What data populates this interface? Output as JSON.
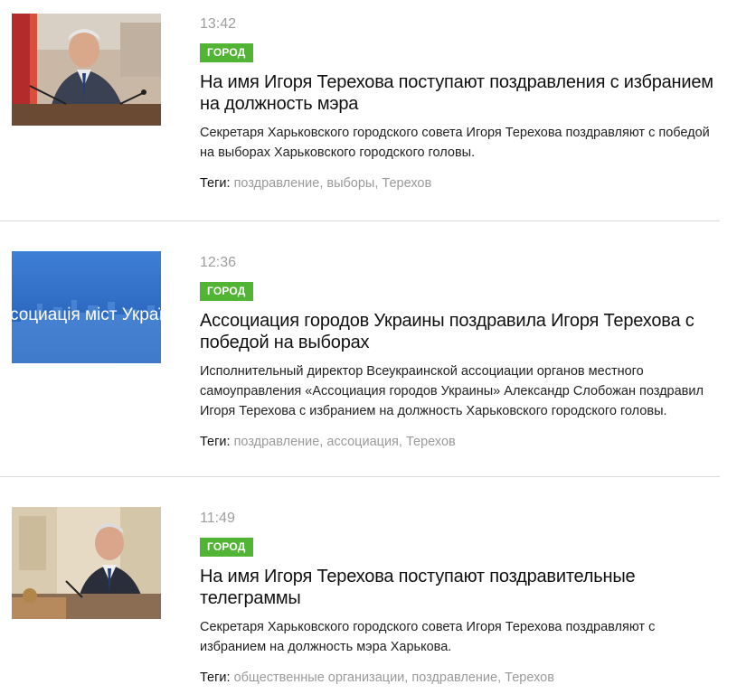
{
  "articles": [
    {
      "time": "13:42",
      "category": "ГОРОД",
      "title": "На имя Игоря Терехова поступают поздравления с избранием на должность мэра",
      "description": "Секретаря Харьковского городского совета Игоря Терехова поздравляют с победой на выборах Харьковского городского головы.",
      "tags_label": "Теги:",
      "tags": [
        "поздравление",
        "выборы",
        "Терехов"
      ],
      "thumbnail": "man-at-microphone-photo"
    },
    {
      "time": "12:36",
      "category": "ГОРОД",
      "title": "Ассоциация городов Украины поздравила Игоря Терехова с победой на выборах",
      "description": "Исполнительный директор Всеукраинской ассоциации органов местного самоуправления «Ассоциация городов Украины» Александр Слобожан поздравил Игоря Терехова с избранием на должность Харьковского городского головы.",
      "tags_label": "Теги:",
      "tags": [
        "поздравление",
        "ассоциация",
        "Терехов"
      ],
      "thumbnail": "association-logo-banner",
      "thumbnail_text": "социація міст Украї"
    },
    {
      "time": "11:49",
      "category": "ГОРОД",
      "title": "На имя Игоря Терехова поступают поздравительные телеграммы",
      "description": "Секретаря Харьковского городского совета Игоря Терехова поздравляют с избранием на должность мэра Харькова.",
      "tags_label": "Теги:",
      "tags": [
        "общественные организации",
        "поздравление",
        "Терехов"
      ],
      "thumbnail": "man-at-desk-photo"
    }
  ],
  "colors": {
    "badge_green": "#52b435",
    "tag_gray": "#9a9a9a",
    "time_gray": "#9e9e9e",
    "banner_blue": "#2d6bc4"
  }
}
